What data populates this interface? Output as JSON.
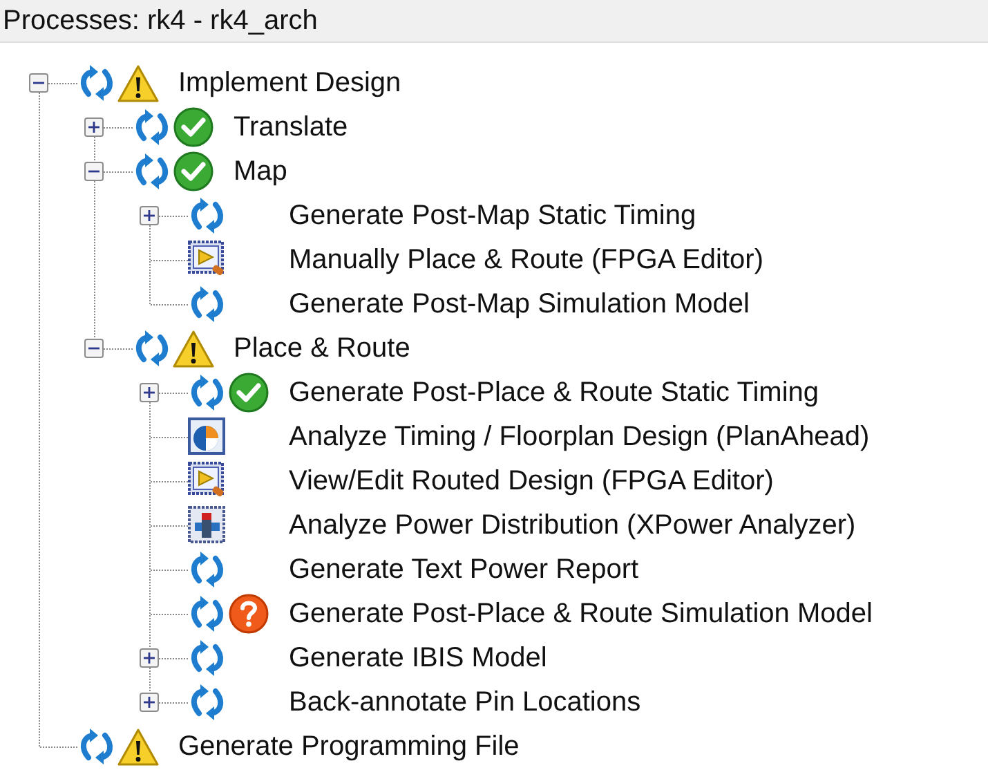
{
  "panel": {
    "title": "Processes: rk4 - rk4_arch",
    "tree": [
      {
        "label": "Implement Design",
        "kind": "process",
        "status": {
          "kind": "warning"
        },
        "expanded": true,
        "children": [
          {
            "label": "Translate",
            "kind": "process",
            "status": {
              "kind": "ok"
            },
            "expanded": false
          },
          {
            "label": "Map",
            "kind": "process",
            "status": {
              "kind": "ok"
            },
            "expanded": true,
            "children": [
              {
                "label": "Generate Post-Map Static Timing",
                "kind": "process",
                "expanded": false
              },
              {
                "label": "Manually Place & Route (FPGA Editor)",
                "kind": "fpga-editor"
              },
              {
                "label": "Generate Post-Map Simulation Model",
                "kind": "process"
              }
            ]
          },
          {
            "label": "Place & Route",
            "kind": "process",
            "status": {
              "kind": "warning"
            },
            "expanded": true,
            "children": [
              {
                "label": "Generate Post-Place & Route Static Timing",
                "kind": "process",
                "status": {
                  "kind": "ok"
                },
                "expanded": false
              },
              {
                "label": "Analyze Timing / Floorplan Design (PlanAhead)",
                "kind": "planahead"
              },
              {
                "label": "View/Edit Routed Design (FPGA Editor)",
                "kind": "fpga-editor"
              },
              {
                "label": "Analyze Power Distribution (XPower Analyzer)",
                "kind": "xpower"
              },
              {
                "label": "Generate Text Power Report",
                "kind": "process"
              },
              {
                "label": "Generate Post-Place & Route Simulation Model",
                "kind": "process",
                "status": {
                  "kind": "question"
                }
              },
              {
                "label": "Generate IBIS Model",
                "kind": "process",
                "expanded": false
              },
              {
                "label": "Back-annotate Pin Locations",
                "kind": "process",
                "expanded": false
              }
            ]
          }
        ]
      },
      {
        "label": "Generate Programming File",
        "kind": "process",
        "status": {
          "kind": "warning"
        }
      }
    ]
  }
}
